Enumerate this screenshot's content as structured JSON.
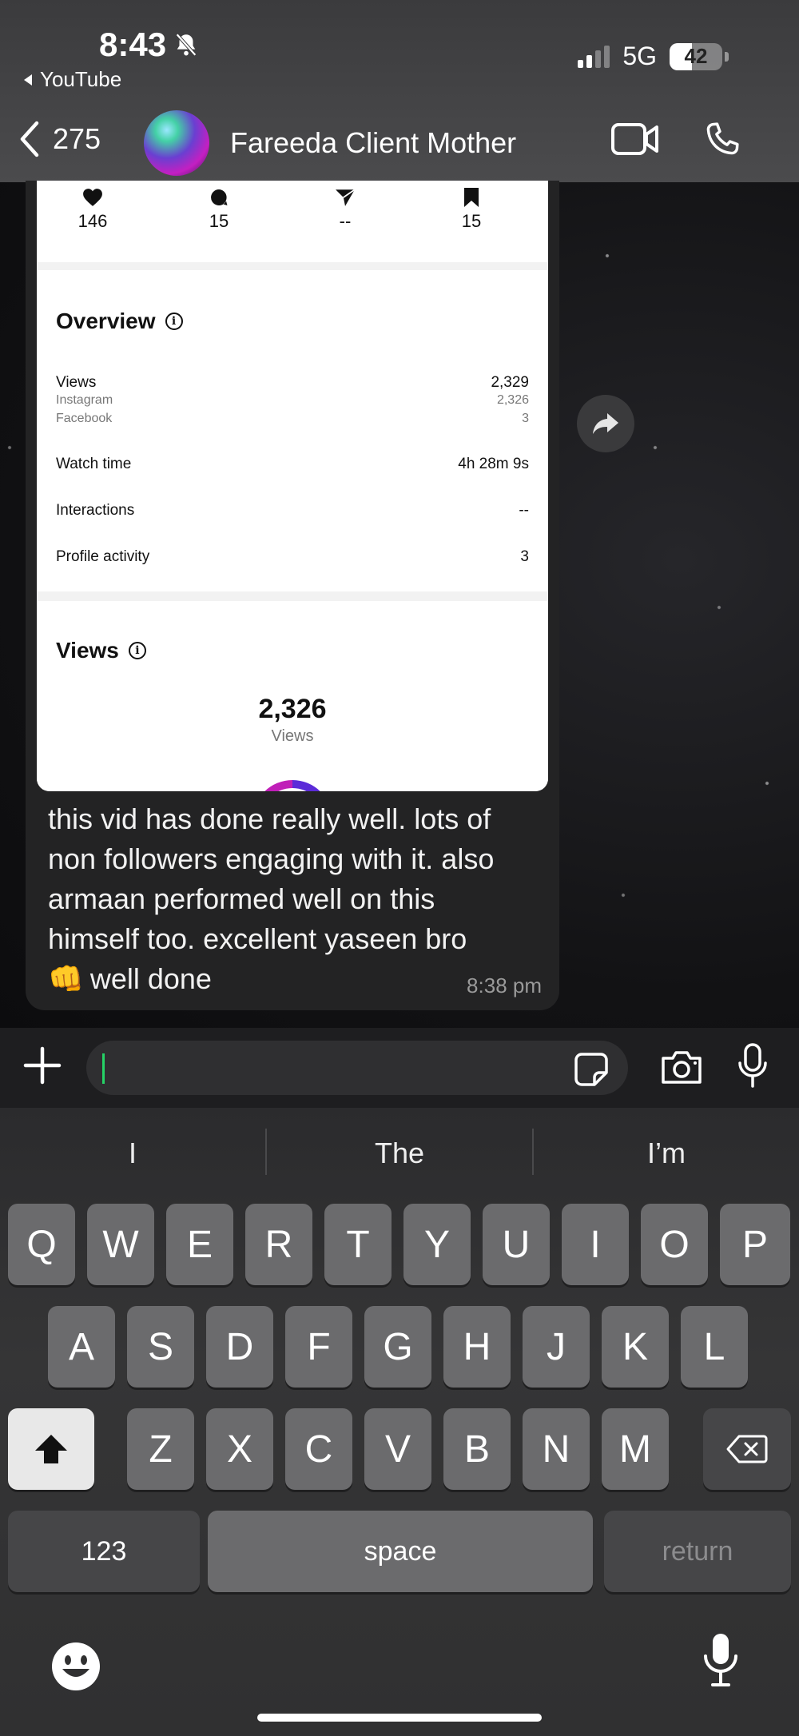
{
  "status_bar": {
    "time": "8:43",
    "back_app": "YouTube",
    "network": "5G",
    "battery": "42",
    "battery_level": 0.42
  },
  "chat_header": {
    "unread_count": "275",
    "contact_name": "Fareeda Client Mother"
  },
  "shared_screenshot": {
    "stats": {
      "likes": "146",
      "comments": "15",
      "shares": "--",
      "saves": "15"
    },
    "overview": {
      "title": "Overview",
      "views_label": "Views",
      "views_value": "2,329",
      "instagram_label": "Instagram",
      "instagram_value": "2,326",
      "facebook_label": "Facebook",
      "facebook_value": "3",
      "watch_time_label": "Watch time",
      "watch_time_value": "4h 28m 9s",
      "interactions_label": "Interactions",
      "interactions_value": "--",
      "profile_activity_label": "Profile activity",
      "profile_activity_value": "3"
    },
    "views_section": {
      "title": "Views",
      "total": "2,326",
      "total_label": "Views"
    }
  },
  "message": {
    "text_line1": "this vid has done really well. lots of",
    "text_line2": "non followers engaging with it. also",
    "text_line3": "armaan performed well on this",
    "text_line4": "himself too. excellent yaseen bro",
    "emoji": "👊",
    "text_line5": "well done",
    "time": "8:38 pm"
  },
  "input": {
    "placeholder": ""
  },
  "keyboard": {
    "suggestions": [
      "I",
      "The",
      "I’m"
    ],
    "row1": [
      "Q",
      "W",
      "E",
      "R",
      "T",
      "Y",
      "U",
      "I",
      "O",
      "P"
    ],
    "row2": [
      "A",
      "S",
      "D",
      "F",
      "G",
      "H",
      "J",
      "K",
      "L"
    ],
    "row3": [
      "Z",
      "X",
      "C",
      "V",
      "B",
      "N",
      "M"
    ],
    "numbers_label": "123",
    "space_label": "space",
    "return_label": "return"
  },
  "colors": {
    "accent_cursor": "#25d366",
    "bubble": "#232324",
    "header": "#3b3b3d"
  }
}
